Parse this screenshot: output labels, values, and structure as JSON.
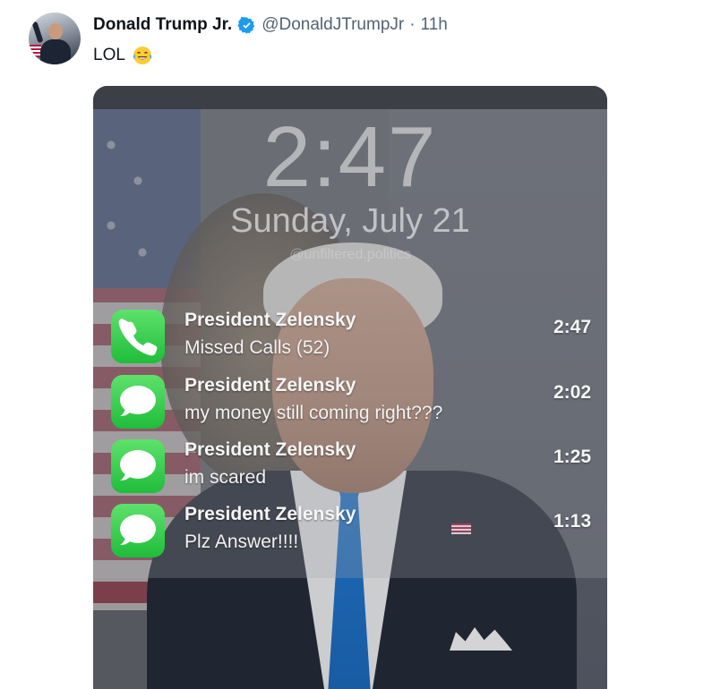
{
  "author": {
    "name": "Donald Trump Jr.",
    "handle": "@DonaldJTrumpJr",
    "timestamp": "11h",
    "verified_icon": "verified-badge-icon",
    "verified_color": "#1d9bf0"
  },
  "tweet": {
    "text": "LOL",
    "emoji": "tears-of-joy-emoji"
  },
  "lockscreen": {
    "time": "2:47",
    "date": "Sunday, July 21",
    "watermark": "@unfiltered.politics",
    "notifications": [
      {
        "app": "phone",
        "icon": "phone-icon",
        "title": "President Zelensky",
        "body": "Missed Calls (52)",
        "time": "2:47"
      },
      {
        "app": "messages",
        "icon": "message-bubble-icon",
        "title": "President Zelensky",
        "body": "my money still coming right???",
        "time": "2:02"
      },
      {
        "app": "messages",
        "icon": "message-bubble-icon",
        "title": "President Zelensky",
        "body": "im scared",
        "time": "1:25"
      },
      {
        "app": "messages",
        "icon": "message-bubble-icon",
        "title": "President Zelensky",
        "body": "Plz Answer!!!!",
        "time": "1:13"
      }
    ],
    "app_icon_color": "#34c759"
  }
}
